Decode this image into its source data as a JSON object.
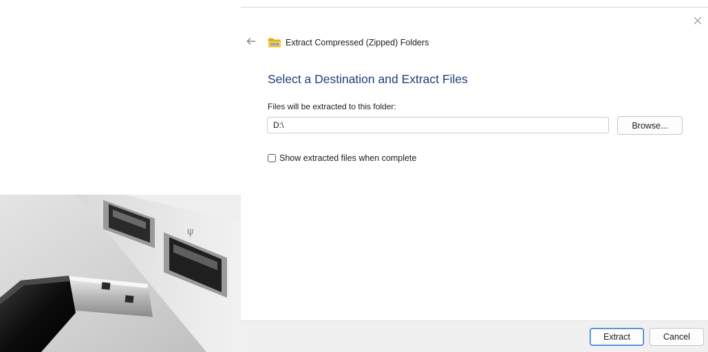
{
  "window": {
    "title": "Extract Compressed (Zipped) Folders",
    "back_icon": "back-arrow-icon",
    "close_icon": "close-icon",
    "folder_icon": "zipped-folder-icon"
  },
  "main": {
    "heading": "Select a Destination and Extract Files",
    "destination_label": "Files will be extracted to this folder:",
    "destination_value": "D:\\",
    "browse_label": "Browse...",
    "show_files_label": "Show extracted files when complete",
    "show_files_checked": false
  },
  "footer": {
    "extract_label": "Extract",
    "cancel_label": "Cancel"
  },
  "colors": {
    "heading": "#1f3d7a",
    "primary_border": "#2f6fc9",
    "footer_bg": "#f0f0f0"
  },
  "photo": {
    "subject": "USB flash drive plugged into laptop port"
  }
}
